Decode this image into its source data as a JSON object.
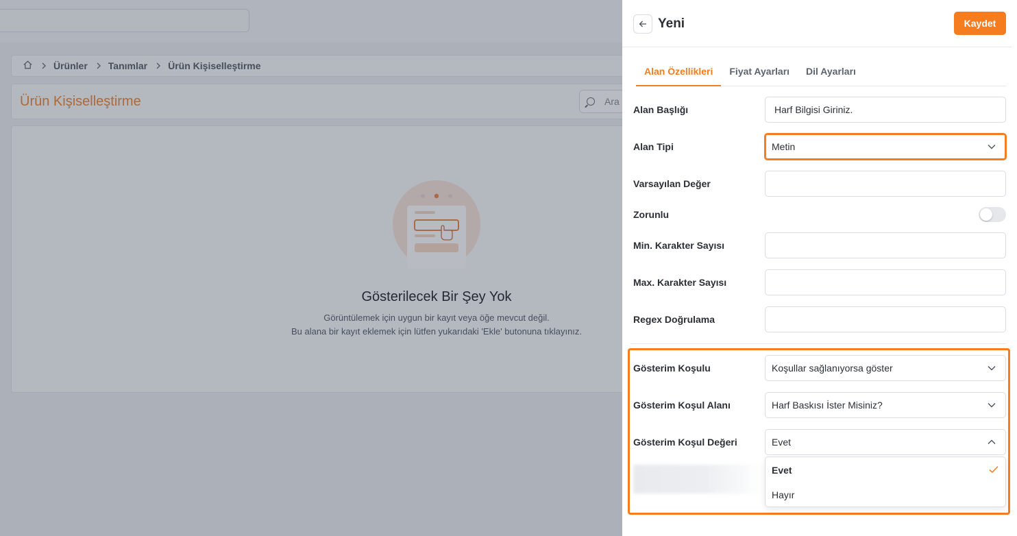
{
  "breadcrumb": {
    "items": [
      "Ürünler",
      "Tanımlar",
      "Ürün Kişiselleştirme"
    ]
  },
  "page": {
    "title": "Ürün Kişiselleştirme",
    "search_placeholder": "Ara",
    "empty_title": "Gösterilecek Bir Şey Yok",
    "empty_line1": "Görüntülemek için uygun bir kayıt veya öğe mevcut değil.",
    "empty_line2": "Bu alana bir kayıt eklemek için lütfen yukarıdaki 'Ekle' butonuna tıklayınız."
  },
  "drawer": {
    "title": "Yeni",
    "save_label": "Kaydet",
    "tabs": [
      "Alan Özellikleri",
      "Fiyat Ayarları",
      "Dil Ayarları"
    ],
    "fields": {
      "alan_basligi": {
        "label": "Alan Başlığı",
        "value": "Harf Bilgisi Giriniz."
      },
      "alan_tipi": {
        "label": "Alan Tipi",
        "value": "Metin"
      },
      "varsayilan": {
        "label": "Varsayılan Değer",
        "value": ""
      },
      "zorunlu": {
        "label": "Zorunlu",
        "checked": false
      },
      "min": {
        "label": "Min. Karakter Sayısı",
        "value": ""
      },
      "max": {
        "label": "Max. Karakter Sayısı",
        "value": ""
      },
      "regex": {
        "label": "Regex Doğrulama",
        "value": ""
      },
      "kosul": {
        "label": "Gösterim Koşulu",
        "value": "Koşullar sağlanıyorsa göster"
      },
      "kosul_alani": {
        "label": "Gösterim Koşul Alanı",
        "value": "Harf Baskısı İster Misiniz?"
      },
      "kosul_degeri": {
        "label": "Gösterim Koşul Değeri",
        "value": "Evet",
        "options": [
          "Evet",
          "Hayır"
        ]
      }
    }
  },
  "colors": {
    "accent": "#f57c1f",
    "title_orange": "#f08a3c"
  },
  "icons": [
    "home-icon",
    "chevron-right-icon",
    "search-icon",
    "back-arrow-icon",
    "chevron-down-icon",
    "chevron-up-icon",
    "check-icon"
  ]
}
